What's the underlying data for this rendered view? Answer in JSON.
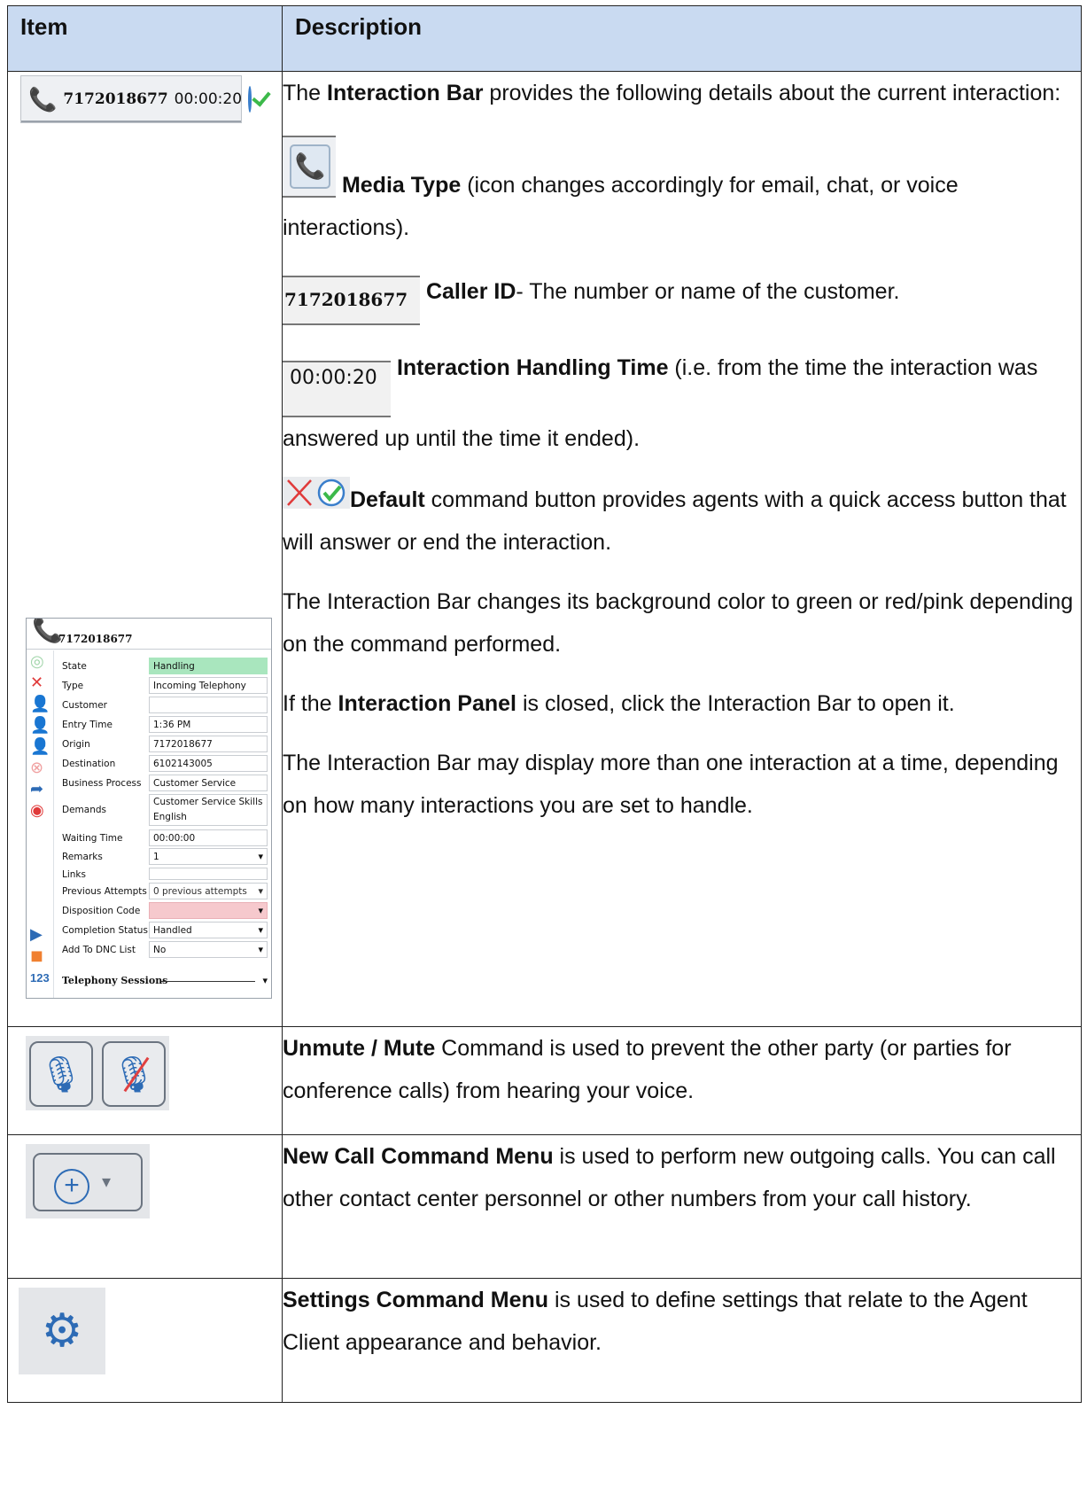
{
  "header": {
    "item": "Item",
    "description": "Description"
  },
  "row1": {
    "bar": {
      "caller_id": "7172018677",
      "time": "00:00:20"
    },
    "intro_pre": "The ",
    "intro_bold": "Interaction Bar",
    "intro_post": " provides the following details about the current interaction:",
    "media_bold": "Media Type",
    "media_text": " (icon changes accordingly for email, chat, or voice interactions).",
    "cid_image_text": "7172018677",
    "cid_bold": "Caller ID",
    "cid_text": "- The number or name of the customer.",
    "time_image_text": "00:00:20",
    "time_bold": "Interaction Handling Time",
    "time_text": " (i.e. from the time the interaction was answered up until the time it ended).",
    "default_bold": "Default",
    "default_text": " command button provides agents with a quick access button that will answer or end the interaction.",
    "bg_text": "The Interaction Bar changes its background color to green or red/pink depending on the command performed.",
    "panel_pre": "If the ",
    "panel_bold": "Interaction Panel",
    "panel_post": " is closed, click the Interaction Bar to open it.",
    "multi_text": "The Interaction Bar may display more than one interaction at a time, depending on how many interactions you are set to handle.",
    "panel": {
      "title": "7172018677",
      "rows": [
        {
          "label": "State",
          "value": "Handling",
          "color": "#a9e6be"
        },
        {
          "label": "Type",
          "value": "Incoming Telephony"
        },
        {
          "label": "Customer",
          "value": ""
        },
        {
          "label": "Entry Time",
          "value": "1:36 PM"
        },
        {
          "label": "Origin",
          "value": "7172018677"
        },
        {
          "label": "Destination",
          "value": "6102143005"
        },
        {
          "label": "Business Process",
          "value": "Customer Service"
        },
        {
          "label": "Demands",
          "value": "Customer Service Skills",
          "value2": "English"
        },
        {
          "label": "Waiting Time",
          "value": "00:00:00"
        },
        {
          "label": "Remarks",
          "value": "1"
        },
        {
          "label": "Links",
          "value": ""
        },
        {
          "label": "Previous Attempts",
          "value": "0 previous attempts"
        },
        {
          "label": "Disposition Code",
          "value": "",
          "color": "#f6c9cd"
        },
        {
          "label": "Completion Status",
          "value": "Handled"
        },
        {
          "label": "Add To DNC List",
          "value": "No"
        }
      ],
      "telephony": "Telephony Sessions",
      "side_number": "123"
    }
  },
  "row2": {
    "bold": "Unmute / Mute",
    "text": " Command is used to prevent the other party (or parties for conference calls) from hearing your voice."
  },
  "row3": {
    "bold": "New Call Command Menu",
    "text": " is used to perform new outgoing calls. You can call other contact center personnel or other numbers from your call history."
  },
  "row4": {
    "bold": "Settings Command Menu",
    "text": " is used to define settings that relate to the Agent Client appearance and behavior."
  }
}
